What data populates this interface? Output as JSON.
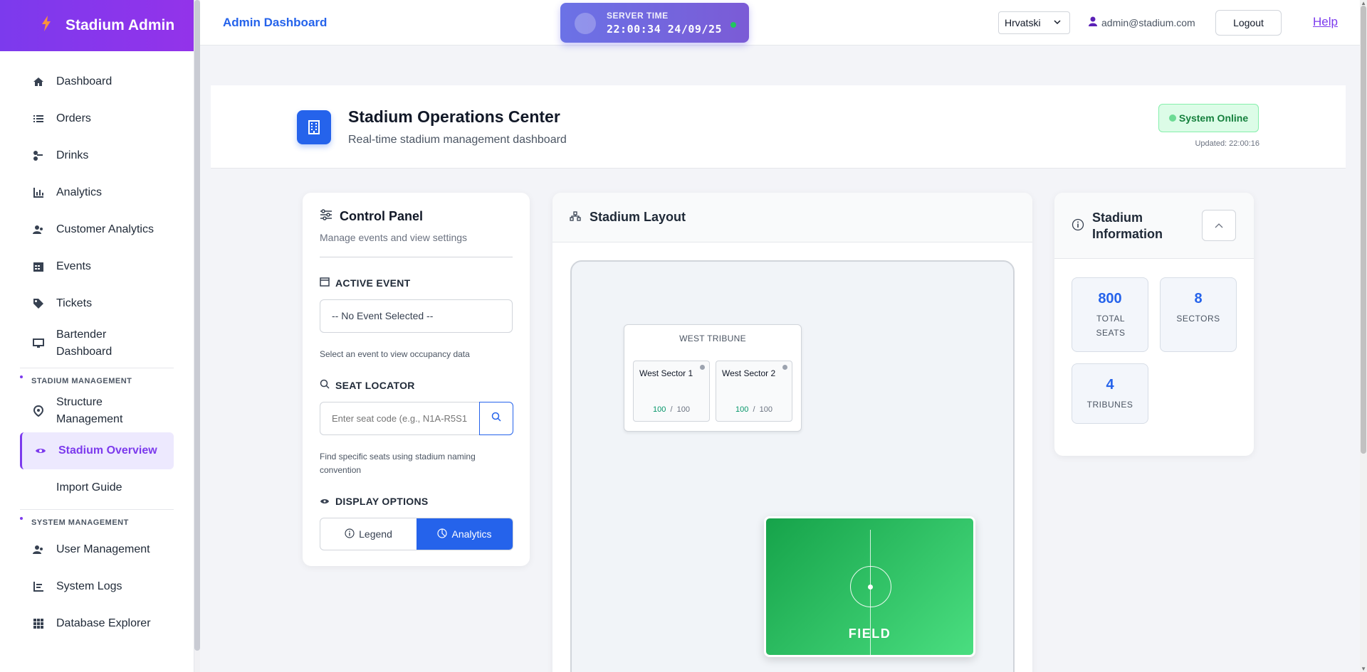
{
  "sidebar": {
    "brand": "Stadium Admin",
    "items": [
      {
        "label": "Dashboard",
        "icon": "home-icon"
      },
      {
        "label": "Orders",
        "icon": "list-icon"
      },
      {
        "label": "Drinks",
        "icon": "drinks-icon"
      },
      {
        "label": "Analytics",
        "icon": "bar-chart-icon"
      },
      {
        "label": "Customer Analytics",
        "icon": "users-icon"
      },
      {
        "label": "Events",
        "icon": "calendar-icon"
      },
      {
        "label": "Tickets",
        "icon": "ticket-icon"
      },
      {
        "label": "Bartender Dashboard",
        "icon": "monitor-icon"
      }
    ],
    "section_stadium": "STADIUM MANAGEMENT",
    "stadium_items": [
      {
        "label": "Structure Management",
        "icon": "map-pin-icon"
      },
      {
        "label": "Stadium Overview",
        "icon": "eye-icon"
      },
      {
        "label": "Import Guide",
        "icon": ""
      }
    ],
    "section_system": "SYSTEM MANAGEMENT",
    "system_items": [
      {
        "label": "User Management",
        "icon": "users-icon"
      },
      {
        "label": "System Logs",
        "icon": "logs-icon"
      },
      {
        "label": "Database Explorer",
        "icon": "grid-icon"
      }
    ]
  },
  "topbar": {
    "title": "Admin Dashboard",
    "server_time_label": "SERVER TIME",
    "server_time_value": "22:00:34 24/09/25",
    "language": "Hrvatski",
    "user_email": "admin@stadium.com",
    "logout_label": "Logout",
    "help_label": "Help"
  },
  "header": {
    "title": "Stadium Operations Center",
    "subtitle": "Real-time stadium management dashboard",
    "status": "System Online",
    "updated": "Updated: 22:00:16"
  },
  "control": {
    "title": "Control Panel",
    "subtitle": "Manage events and view settings",
    "active_event_label": "ACTIVE EVENT",
    "active_event_value": "-- No Event Selected --",
    "active_event_hint": "Select an event to view occupancy data",
    "seat_locator_label": "SEAT LOCATOR",
    "seat_placeholder": "Enter seat code (e.g., N1A-R5S1",
    "seat_hint": "Find specific seats using stadium naming convention",
    "display_label": "DISPLAY OPTIONS",
    "legend_label": "Legend",
    "analytics_label": "Analytics"
  },
  "layout": {
    "title": "Stadium Layout",
    "tribune_name": "WEST TRIBUNE",
    "sectors": [
      {
        "name": "West Sector 1",
        "available": "100",
        "sep": "/",
        "total": "100"
      },
      {
        "name": "West Sector 2",
        "available": "100",
        "sep": "/",
        "total": "100"
      }
    ],
    "field_label": "FIELD"
  },
  "info": {
    "title": "Stadium Information",
    "stats": [
      {
        "value": "800",
        "label": "TOTAL SEATS"
      },
      {
        "value": "8",
        "label": "SECTORS"
      },
      {
        "value": "4",
        "label": "TRIBUNES"
      }
    ]
  },
  "colors": {
    "brand": "#7c3aed",
    "primary": "#2563eb",
    "online": "#22c55e",
    "field": "#22c55e"
  }
}
